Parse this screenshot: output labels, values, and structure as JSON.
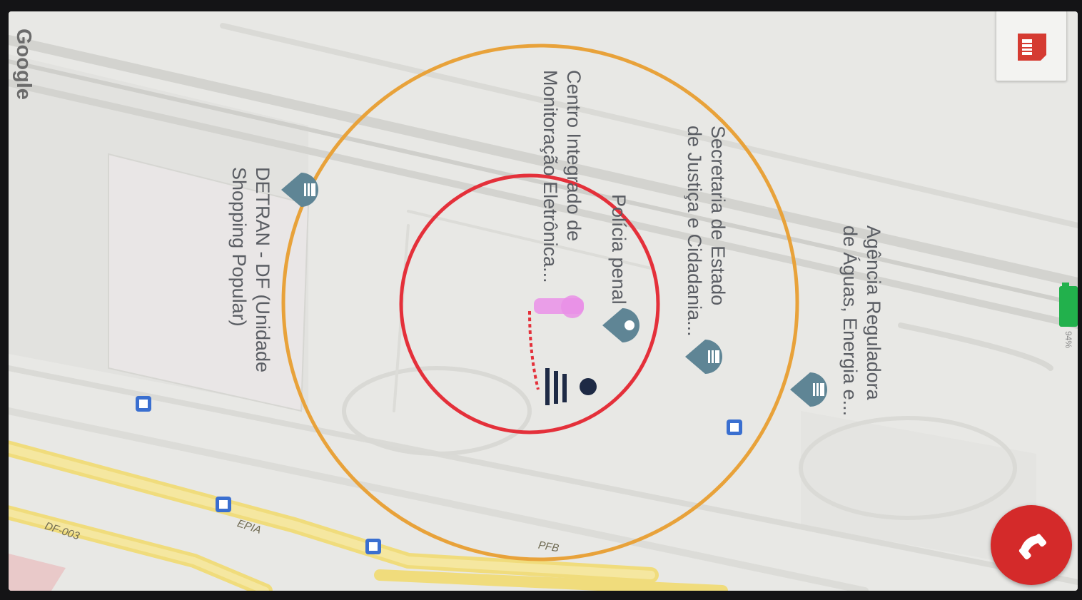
{
  "map": {
    "attribution": "Google",
    "places": [
      {
        "name": "Agência Reguladora de Águas, Energia e...",
        "lines": [
          "Agência Reguladora",
          "de Águas, Energia e..."
        ],
        "icon": "government-building-icon"
      },
      {
        "name": "Secretaria de Estado de Justiça e Cidadania...",
        "lines": [
          "Secretaria de Estado",
          "de Justiça e Cidadania..."
        ],
        "icon": "government-building-icon"
      },
      {
        "name": "Polícia penal",
        "lines": [
          "Polícia penal"
        ],
        "icon": "location-pin-icon"
      },
      {
        "name": "Centro Integrado de Monitoração Eletrônica...",
        "lines": [
          "Centro Integrado de",
          "Monitoração Eletrônica..."
        ],
        "icon": "person-marker-icon"
      },
      {
        "name": "DETRAN - DF (Unidade Shopping Popular)",
        "lines": [
          "DETRAN - DF (Unidade",
          "Shopping Popular)"
        ],
        "icon": "government-building-icon"
      }
    ],
    "roads": [
      "EPIA",
      "DF-003",
      "PFB"
    ],
    "zones": [
      {
        "name": "outer-zone",
        "color": "#e8a23a"
      },
      {
        "name": "inner-zone",
        "color": "#e4303a"
      }
    ],
    "bus_stop_icon": "bus-stop-icon"
  },
  "status": {
    "battery": "94%",
    "battery_color": "#22b14c"
  },
  "controls": {
    "sim_icon": "sim-card-icon",
    "call_icon": "phone-hangup-icon",
    "call_color": "#d42a2a"
  }
}
